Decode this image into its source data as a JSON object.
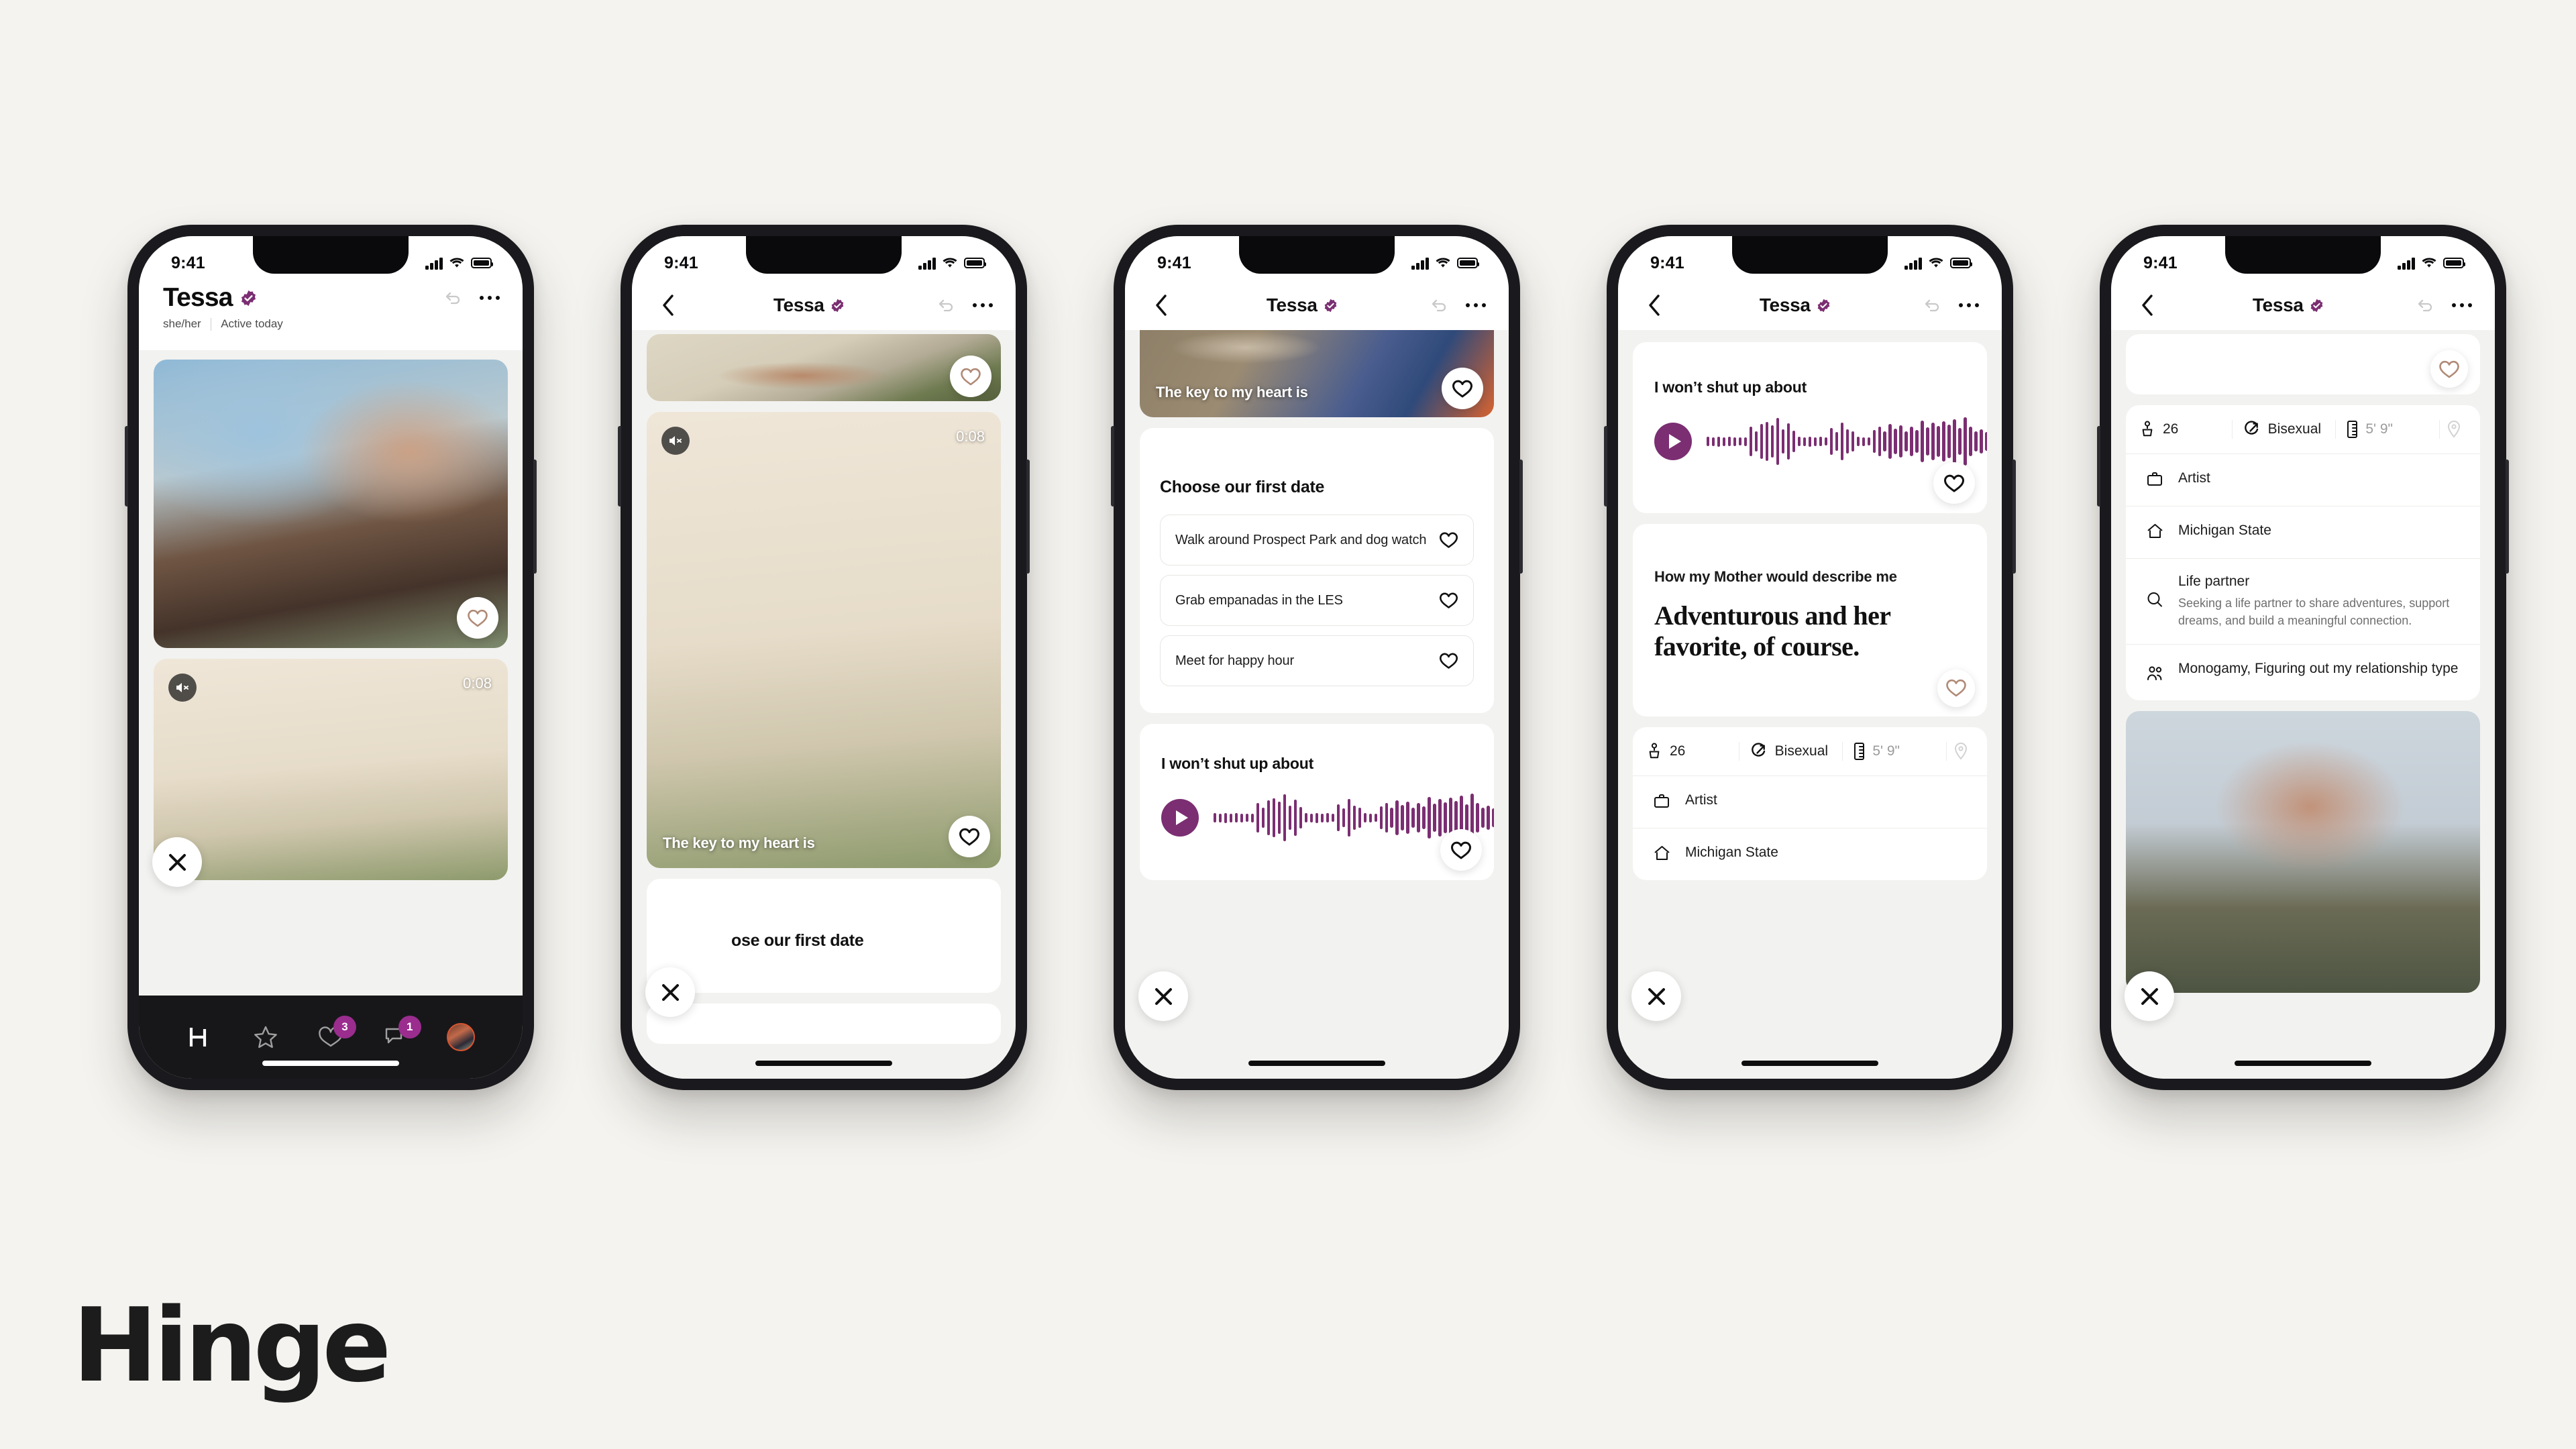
{
  "brand": {
    "wordmark": "Hinge"
  },
  "status_bar": {
    "time": "9:41"
  },
  "profile": {
    "name": "Tessa",
    "pronouns": "she/her",
    "activity": "Active today"
  },
  "phone1": {
    "header": {
      "name": "Tessa",
      "pronouns": "she/her",
      "activity": "Active today"
    },
    "video": {
      "duration": "0:08"
    },
    "tabs": [
      {
        "name": "discover",
        "icon": "hinge-logo-icon",
        "badge": ""
      },
      {
        "name": "standouts",
        "icon": "star-icon",
        "badge": ""
      },
      {
        "name": "likes-you",
        "icon": "heart-icon",
        "badge": "3"
      },
      {
        "name": "matches",
        "icon": "chat-icon",
        "badge": "1"
      },
      {
        "name": "profile",
        "icon": "avatar-icon",
        "badge": ""
      }
    ]
  },
  "phone2": {
    "header": {
      "name": "Tessa"
    },
    "video": {
      "duration": "0:08",
      "caption": "The key to my heart is"
    },
    "poll_partial": "ose our first date"
  },
  "phone3": {
    "header": {
      "name": "Tessa"
    },
    "video_caption": "The key to my heart is",
    "poll": {
      "question": "Choose our first date",
      "options": [
        "Walk around Prospect Park and dog watch",
        "Grab empanadas in the LES",
        "Meet for happy hour"
      ]
    },
    "voice_prompt": {
      "question": "I won’t shut up about"
    }
  },
  "phone4": {
    "header": {
      "name": "Tessa"
    },
    "voice_prompt": {
      "question": "I won’t shut up about"
    },
    "text_prompt": {
      "question": "How my Mother would describe me",
      "answer": "Adventurous and her favorite, of course."
    },
    "attributes_top": [
      {
        "icon": "age-icon",
        "value": "26",
        "muted": false
      },
      {
        "icon": "sexuality-icon",
        "value": "Bisexual",
        "muted": false
      },
      {
        "icon": "ruler-icon",
        "value": "5' 9\"",
        "muted": true
      },
      {
        "icon": "location-pin-icon",
        "value": "",
        "muted": true
      }
    ],
    "attributes_rows": [
      {
        "icon": "briefcase-icon",
        "label": "Artist"
      },
      {
        "icon": "home-icon",
        "label": "Michigan State"
      }
    ]
  },
  "phone5": {
    "header": {
      "name": "Tessa"
    },
    "attributes_top": [
      {
        "icon": "age-icon",
        "value": "26",
        "muted": false
      },
      {
        "icon": "sexuality-icon",
        "value": "Bisexual",
        "muted": false
      },
      {
        "icon": "ruler-icon",
        "value": "5' 9\"",
        "muted": true
      },
      {
        "icon": "location-pin-icon",
        "value": "",
        "muted": true
      }
    ],
    "attributes_rows": [
      {
        "icon": "briefcase-icon",
        "title": "Artist",
        "sub": ""
      },
      {
        "icon": "home-icon",
        "title": "Michigan State",
        "sub": ""
      },
      {
        "icon": "search-icon",
        "title": "Life partner",
        "sub": "Seeking a life partner to share adventures, support dreams, and build a meaningful connection."
      },
      {
        "icon": "people-icon",
        "title": "Monogamy, Figuring out my relationship type",
        "sub": ""
      }
    ]
  },
  "colors": {
    "brand_purple": "#7b2e72",
    "badge_purple": "#9a2d8e",
    "verified_purple": "#7b2e72",
    "heart_tan": "#b08a76",
    "page_bg": "#f4f3ef",
    "screen_bg": "#f2f2f0",
    "tabbar_bg": "#17171a"
  },
  "waveform": [
    14,
    13,
    15,
    13,
    14,
    13,
    12,
    13,
    44,
    30,
    52,
    58,
    48,
    70,
    36,
    54,
    32,
    14,
    13,
    15,
    13,
    14,
    12,
    40,
    28,
    56,
    36,
    30,
    14,
    13,
    12,
    34,
    44,
    30,
    52,
    38,
    48,
    30,
    44,
    34,
    62,
    42,
    56,
    46,
    60,
    50,
    66,
    40,
    72,
    44,
    30,
    36,
    28,
    32,
    13,
    14,
    12,
    13,
    14
  ]
}
